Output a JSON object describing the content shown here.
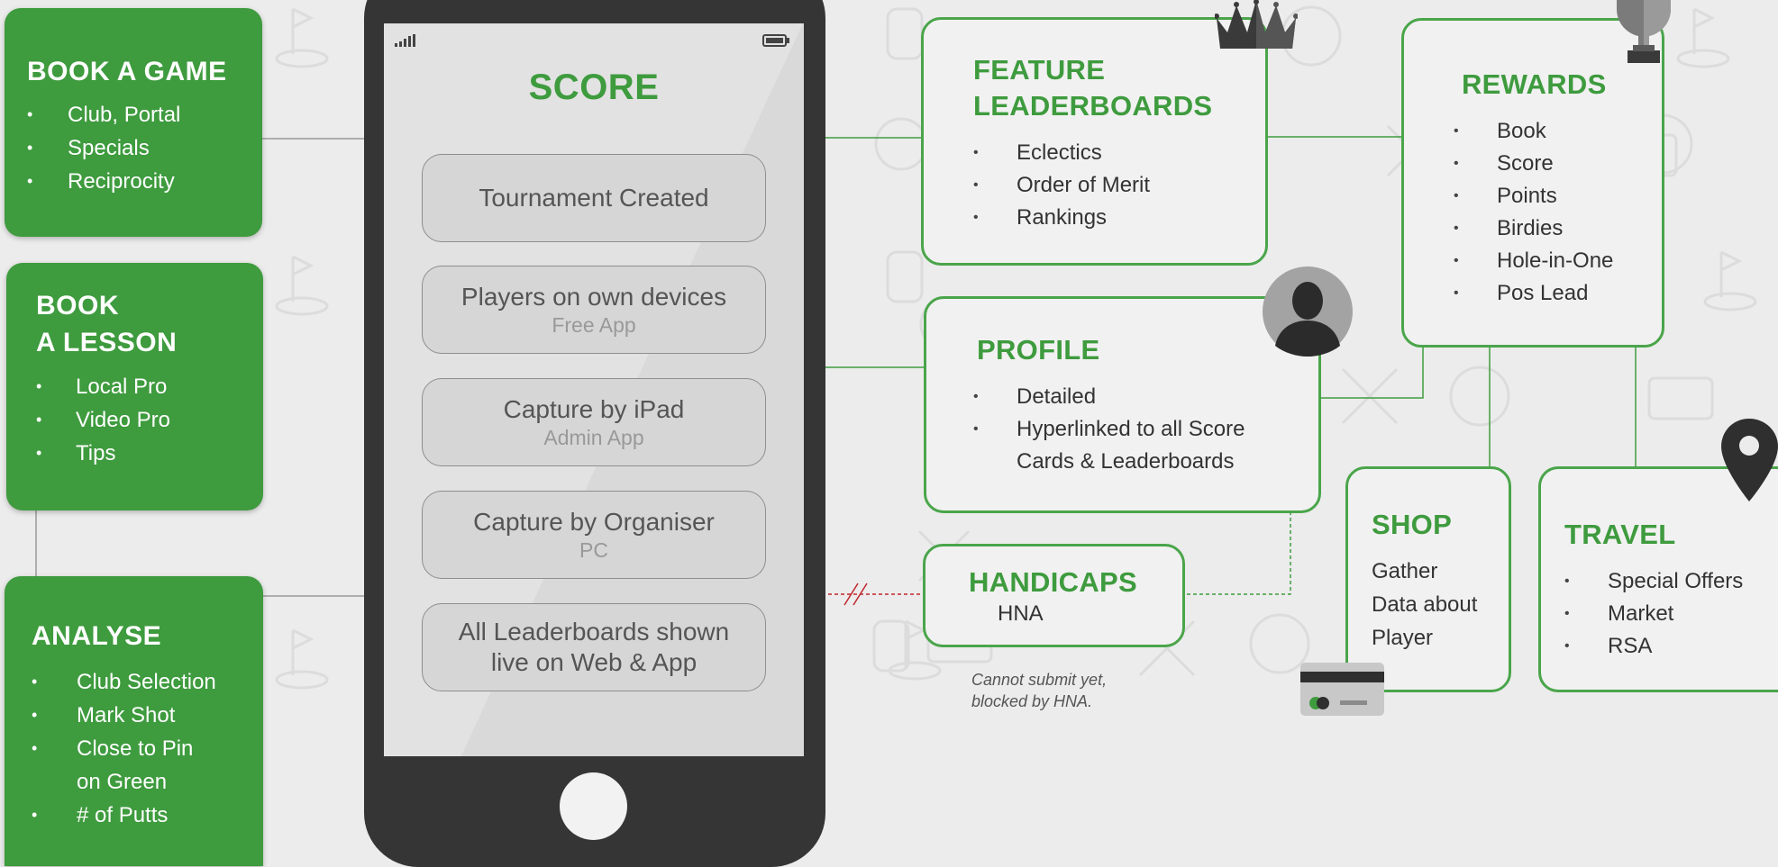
{
  "colors": {
    "green": "#3e9b3e",
    "line_gray": "#9a9a9a",
    "red_dash": "#c0272d",
    "phone_body": "#353535"
  },
  "left_cards": {
    "book_game": {
      "title": "BOOK A GAME",
      "items": [
        "Club, Portal",
        "Specials",
        "Reciprocity"
      ]
    },
    "book_lesson": {
      "title_line1": "BOOK",
      "title_line2": "A LESSON",
      "items": [
        "Local Pro",
        "Video Pro",
        "Tips"
      ]
    },
    "analyse": {
      "title": "ANALYSE",
      "items": [
        "Club Selection",
        "Mark Shot",
        "Close to Pin",
        "on Green",
        "# of Putts"
      ]
    }
  },
  "phone": {
    "title": "SCORE",
    "buttons": [
      {
        "main": "Tournament Created",
        "sub": ""
      },
      {
        "main": "Players on own devices",
        "sub": "Free App"
      },
      {
        "main": "Capture by iPad",
        "sub": "Admin App"
      },
      {
        "main": "Capture by Organiser",
        "sub": "PC"
      },
      {
        "main": "All Leaderboards shown",
        "sub": "live on Web & App"
      }
    ]
  },
  "right_cards": {
    "leaderboards": {
      "title_line1": "FEATURE",
      "title_line2": "LEADERBOARDS",
      "items": [
        "Eclectics",
        "Order of Merit",
        "Rankings"
      ]
    },
    "rewards": {
      "title": "REWARDS",
      "items": [
        "Book",
        "Score",
        "Points",
        "Birdies",
        "Hole-in-One",
        "Pos Lead"
      ]
    },
    "profile": {
      "title": "PROFILE",
      "items": [
        "Detailed",
        "Hyperlinked to all Score",
        "Cards & Leaderboards"
      ]
    },
    "handicaps": {
      "title": "HANDICAPS",
      "sub": "HNA"
    },
    "shop": {
      "title": "SHOP",
      "lines": [
        "Gather",
        "Data about",
        "Player"
      ]
    },
    "travel": {
      "title": "TRAVEL",
      "items": [
        "Special Offers",
        "Market",
        "RSA"
      ]
    }
  },
  "note": {
    "line1": "Cannot submit yet,",
    "line2": "blocked by HNA."
  },
  "icons": [
    "crown-icon",
    "trophy-icon",
    "avatar-icon",
    "location-pin-icon",
    "credit-card-icon",
    "signal-icon",
    "battery-icon"
  ]
}
